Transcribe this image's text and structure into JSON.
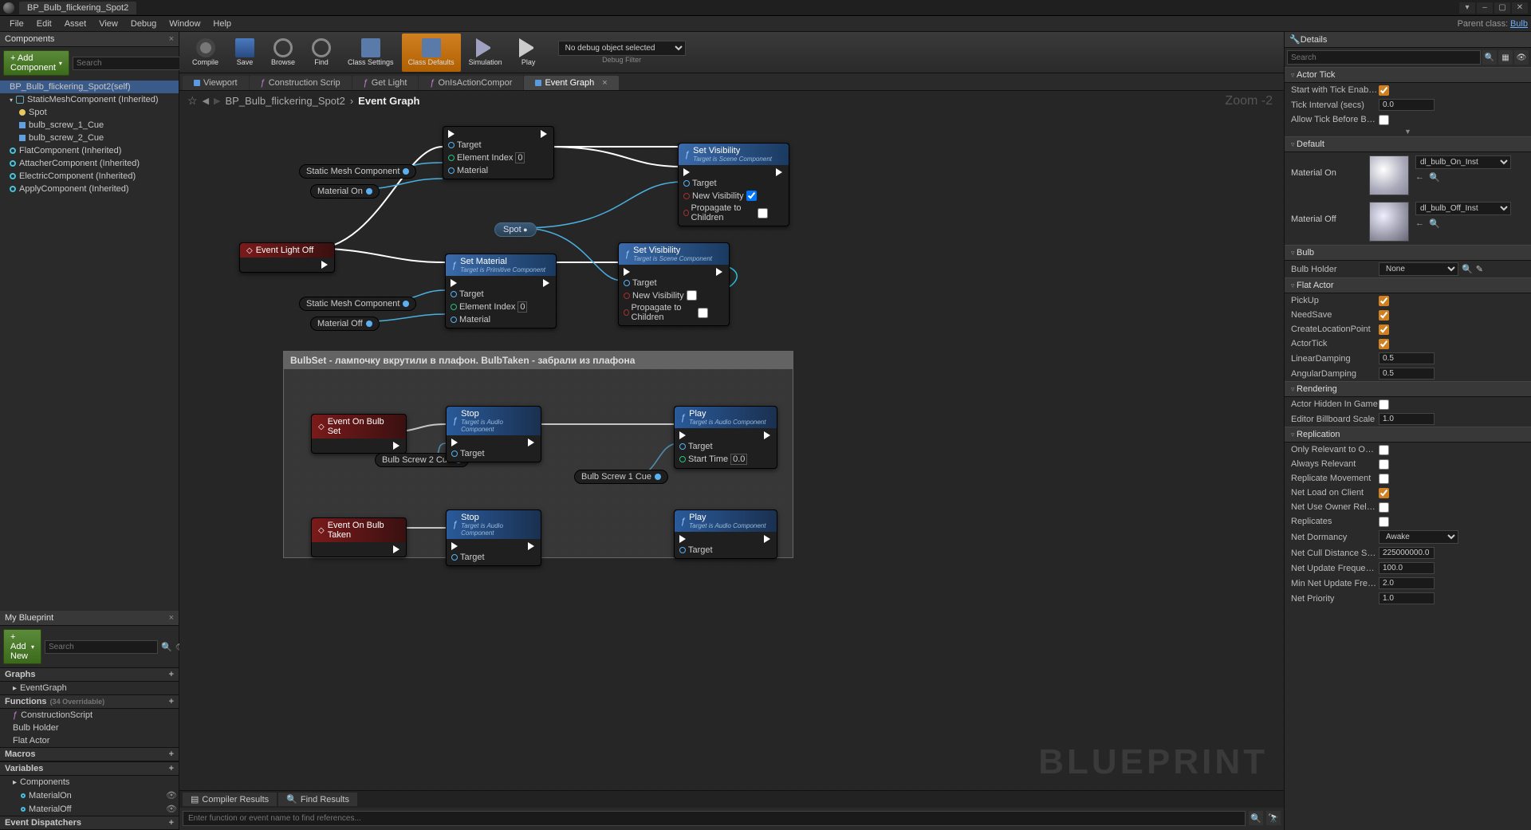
{
  "window": {
    "title": "BP_Bulb_flickering_Spot2"
  },
  "win_controls": {
    "min": "–",
    "max": "▢",
    "close": "✕",
    "down": "▾"
  },
  "menubar": {
    "items": [
      "File",
      "Edit",
      "Asset",
      "View",
      "Debug",
      "Window",
      "Help"
    ],
    "parent_label": "Parent class:",
    "parent_class": "Bulb"
  },
  "components_panel": {
    "title": "Components",
    "add_btn": "+ Add Component",
    "search_placeholder": "Search",
    "items": [
      {
        "label": "BP_Bulb_flickering_Spot2(self)",
        "indent": 0,
        "icon": "comp"
      },
      {
        "label": "StaticMeshComponent (Inherited)",
        "indent": 0,
        "icon": "comp",
        "caret": true
      },
      {
        "label": "Spot",
        "indent": 1,
        "icon": "bulb"
      },
      {
        "label": "bulb_screw_1_Cue",
        "indent": 1,
        "icon": "audio"
      },
      {
        "label": "bulb_screw_2_Cue",
        "indent": 1,
        "icon": "audio"
      },
      {
        "label": "FlatComponent (Inherited)",
        "indent": 0,
        "icon": "cyan"
      },
      {
        "label": "AttacherComponent (Inherited)",
        "indent": 0,
        "icon": "cyan"
      },
      {
        "label": "ElectricComponent (Inherited)",
        "indent": 0,
        "icon": "cyan"
      },
      {
        "label": "ApplyComponent (Inherited)",
        "indent": 0,
        "icon": "cyan"
      }
    ]
  },
  "mybp": {
    "title": "My Blueprint",
    "add_btn": "+ Add New",
    "search_placeholder": "Search",
    "sections": {
      "graphs": {
        "label": "Graphs",
        "items": [
          "EventGraph"
        ]
      },
      "functions": {
        "label": "Functions",
        "count": "(34 Overridable)",
        "items": [
          "ConstructionScript",
          "Bulb Holder",
          "Flat Actor"
        ]
      },
      "macros": {
        "label": "Macros"
      },
      "variables": {
        "label": "Variables",
        "sub": "Components",
        "items": [
          "MaterialOn",
          "MaterialOff"
        ]
      },
      "dispatchers": {
        "label": "Event Dispatchers"
      }
    }
  },
  "toolbar": {
    "buttons": [
      {
        "label": "Compile",
        "icon": "gear"
      },
      {
        "label": "Save",
        "icon": "disk"
      },
      {
        "label": "Browse",
        "icon": "folder"
      },
      {
        "label": "Find",
        "icon": "lens"
      },
      {
        "label": "Class Settings",
        "icon": "class"
      },
      {
        "label": "Class Defaults",
        "icon": "class",
        "active": true
      },
      {
        "label": "Simulation",
        "icon": "play"
      },
      {
        "label": "Play",
        "icon": "play"
      }
    ],
    "debug_selected": "No debug object selected",
    "debug_label": "Debug Filter"
  },
  "graph_tabs": [
    "Viewport",
    "Construction Scrip",
    "Get Light",
    "OnIsActionCompor",
    "Event Graph"
  ],
  "graph_tabs_active": 4,
  "breadcrumb": {
    "root": "BP_Bulb_flickering_Spot2",
    "current": "Event Graph"
  },
  "zoom": "Zoom -2",
  "watermark": "BLUEPRINT",
  "comment_title": "BulbSet - лампочку вкрутили в плафон. BulbTaken - забрали из плафона",
  "nodes": {
    "ev_light_off": "Event Light Off",
    "ev_bulb_set": "Event On Bulb Set",
    "ev_bulb_taken": "Event On Bulb Taken",
    "set_material": "Set Material",
    "set_material_sub": "Target is Primitive Component",
    "set_visibility": "Set Visibility",
    "set_visibility_sub": "Target is Scene Component",
    "stop": "Stop",
    "play": "Play",
    "audio_sub": "Target is Audio Component",
    "var_smc": "Static Mesh Component",
    "var_mat_on": "Material On",
    "var_mat_off": "Material Off",
    "var_spot": "Spot",
    "var_bs1": "Bulb Screw 1 Cue",
    "var_bs2": "Bulb Screw 2 Cue",
    "pin_target": "Target",
    "pin_elem_idx": "Element Index",
    "pin_material": "Material",
    "pin_new_vis": "New Visibility",
    "pin_propagate": "Propagate to Children",
    "pin_start_time": "Start Time",
    "pin_elem_val": "0",
    "pin_start_val": "0.0"
  },
  "bottom": {
    "tabs": [
      "Compiler Results",
      "Find Results"
    ],
    "search_placeholder": "Enter function or event name to find references..."
  },
  "details": {
    "title": "Details",
    "search_placeholder": "Search",
    "actor_tick": {
      "label": "Actor Tick",
      "start_enabled": "Start with Tick Enabled",
      "interval": "Tick Interval (secs)",
      "interval_val": "0.0",
      "allow_before": "Allow Tick Before Begin"
    },
    "default": {
      "label": "Default",
      "mat_on": "Material On",
      "mat_on_val": "dl_bulb_On_Inst",
      "mat_off": "Material Off",
      "mat_off_val": "dl_bulb_Off_Inst"
    },
    "bulb": {
      "label": "Bulb",
      "holder": "Bulb Holder",
      "holder_val": "None"
    },
    "flat": {
      "label": "Flat Actor",
      "pickup": "PickUp",
      "needsave": "NeedSave",
      "clp": "CreateLocationPoint",
      "atick": "ActorTick",
      "ldamp": "LinearDamping",
      "ldamp_val": "0.5",
      "adamp": "AngularDamping",
      "adamp_val": "0.5"
    },
    "rendering": {
      "label": "Rendering",
      "hidden": "Actor Hidden In Game",
      "billboard": "Editor Billboard Scale",
      "billboard_val": "1.0"
    },
    "replication": {
      "label": "Replication",
      "only_owner": "Only Relevant to Owner",
      "always": "Always Relevant",
      "repl_move": "Replicate Movement",
      "net_load": "Net Load on Client",
      "net_use_owner": "Net Use Owner Relevan",
      "replicates": "Replicates",
      "dormancy": "Net Dormancy",
      "dormancy_val": "Awake",
      "cull": "Net Cull Distance Squar",
      "cull_val": "225000000.0",
      "update_freq": "Net Update Frequency",
      "update_freq_val": "100.0",
      "min_update": "Min Net Update Frequen",
      "min_update_val": "2.0",
      "priority": "Net Priority",
      "priority_val": "1.0"
    }
  }
}
